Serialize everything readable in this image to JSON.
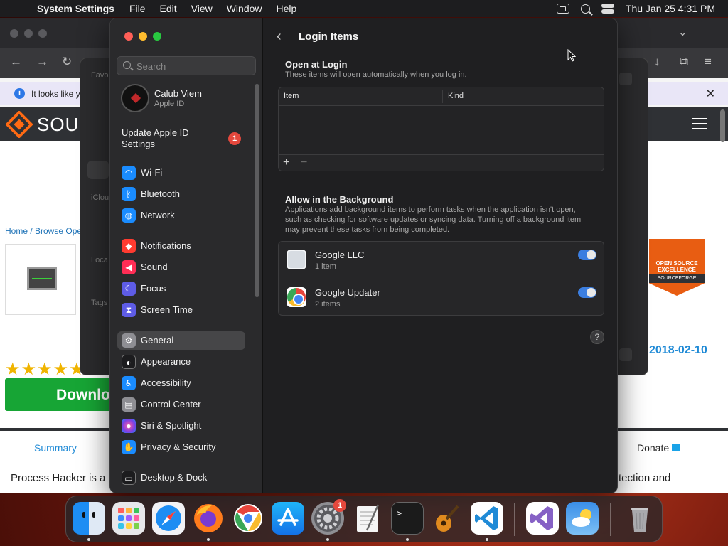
{
  "menubar": {
    "app_name": "System Settings",
    "menus": [
      "File",
      "Edit",
      "View",
      "Window",
      "Help"
    ],
    "datetime": "Thu Jan 25  4:31 PM"
  },
  "browser": {
    "notice_text": "It looks like y",
    "site_name": "SOUR",
    "breadcrumb": "Home / Browse Ope",
    "stars": "★★★★★",
    "download_label": "Downlo",
    "date": "2018-02-10",
    "tab_summary": "Summary",
    "tab_donate": "Donate",
    "summary_text": "Process Hacker is a",
    "summary_tail": "tection and",
    "badge_line1": "OPEN SOURCE EXCELLENCE",
    "badge_line2": "SOURCEFORGE"
  },
  "finder": {
    "labels": [
      "Favo",
      "iClou",
      "Loca",
      "Tags"
    ]
  },
  "settings": {
    "search_placeholder": "Search",
    "profile": {
      "name": "Calub Viem",
      "subtitle": "Apple ID"
    },
    "update": {
      "label": "Update Apple ID Settings",
      "badge": "1"
    },
    "nav": [
      {
        "label": "Wi-Fi",
        "icon": "wifi-icon",
        "color": "#1a8cff"
      },
      {
        "label": "Bluetooth",
        "icon": "bluetooth-icon",
        "color": "#1a8cff"
      },
      {
        "label": "Network",
        "icon": "globe-icon",
        "color": "#1a8cff"
      },
      {
        "label": "Notifications",
        "icon": "bell-icon",
        "color": "#ff3b30"
      },
      {
        "label": "Sound",
        "icon": "speaker-icon",
        "color": "#ff2d55"
      },
      {
        "label": "Focus",
        "icon": "moon-icon",
        "color": "#5e5ce6"
      },
      {
        "label": "Screen Time",
        "icon": "hourglass-icon",
        "color": "#5e5ce6"
      },
      {
        "label": "General",
        "icon": "gear-icon",
        "color": "#8e8e93"
      },
      {
        "label": "Appearance",
        "icon": "appearance-icon",
        "color": "#1c1c1e"
      },
      {
        "label": "Accessibility",
        "icon": "accessibility-icon",
        "color": "#1a8cff"
      },
      {
        "label": "Control Center",
        "icon": "control-center-icon",
        "color": "#8e8e93"
      },
      {
        "label": "Siri & Spotlight",
        "icon": "siri-icon",
        "color": "#7b3fe4"
      },
      {
        "label": "Privacy & Security",
        "icon": "hand-icon",
        "color": "#1a8cff"
      },
      {
        "label": "Desktop & Dock",
        "icon": "desktop-icon",
        "color": "#1c1c1e"
      }
    ],
    "active_nav": "General",
    "page_title": "Login Items",
    "open_at_login": {
      "title": "Open at Login",
      "subtitle": "These items will open automatically when you log in.",
      "columns": [
        "Item",
        "Kind"
      ],
      "add_label": "+",
      "remove_label": "−"
    },
    "background": {
      "title": "Allow in the Background",
      "subtitle": "Applications add background items to perform tasks when the application isn't open, such as checking for software updates or syncing data. Turning off a background item may prevent these tasks from being completed.",
      "items": [
        {
          "name": "Google LLC",
          "count": "1 item",
          "enabled": true,
          "icon": "google-blank-icon"
        },
        {
          "name": "Google Updater",
          "count": "2 items",
          "enabled": true,
          "icon": "chrome-icon"
        }
      ]
    },
    "help_label": "?"
  },
  "dock": {
    "apps": [
      "Finder",
      "Launchpad",
      "Safari",
      "Firefox",
      "Chrome",
      "App Store",
      "System Settings",
      "TextEdit",
      "Terminal",
      "GarageBand",
      "Visual Studio Code",
      "Visual Studio",
      "Weather",
      "Trash"
    ],
    "settings_badge": "1",
    "terminal_prompt": ">_"
  }
}
